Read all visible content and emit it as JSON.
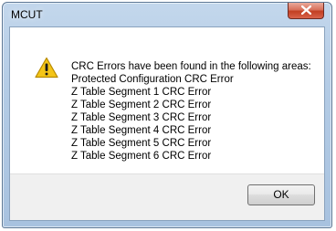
{
  "window": {
    "title": "MCUT",
    "close_icon": "close-icon"
  },
  "message": {
    "icon": "warning-icon",
    "header": "CRC Errors have been found in the following areas:",
    "lines": [
      "Protected Configuration CRC Error",
      "Z Table Segment 1 CRC Error",
      "Z Table Segment 2 CRC Error",
      "Z Table Segment 3 CRC Error",
      "Z Table Segment 4 CRC Error",
      "Z Table Segment 5 CRC Error",
      "Z Table Segment 6 CRC Error"
    ]
  },
  "buttons": {
    "ok_label": "OK"
  },
  "colors": {
    "title_bar": "#b3cbe5",
    "close_button": "#c23f22",
    "warning_fill": "#f4c518",
    "footer": "#f0f0f0"
  }
}
